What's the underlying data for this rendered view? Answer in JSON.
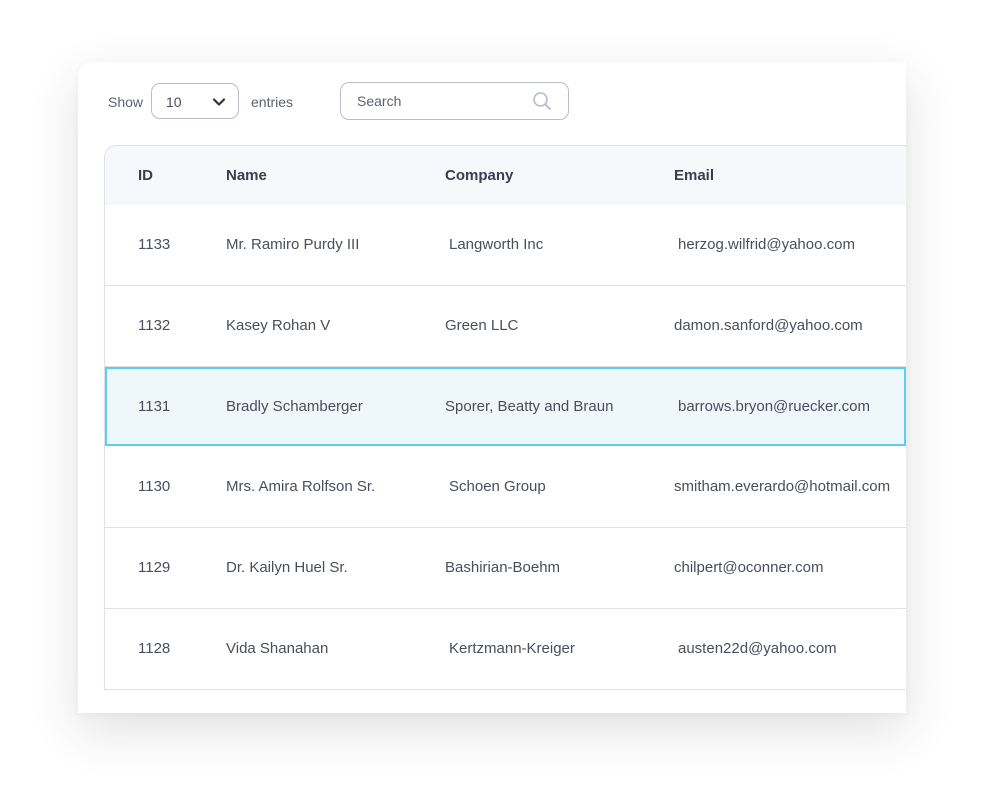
{
  "controls": {
    "show_label": "Show",
    "page_size": "10",
    "entries_label": "entries",
    "search_placeholder": "Search"
  },
  "table": {
    "columns": [
      "ID",
      "Name",
      "Company",
      "Email"
    ],
    "rows": [
      {
        "id": "1133",
        "name": "Mr. Ramiro Purdy III",
        "company": "Langworth Inc",
        "email": "herzog.wilfrid@yahoo.com"
      },
      {
        "id": "1132",
        "name": "Kasey Rohan V",
        "company": "Green LLC",
        "email": "damon.sanford@yahoo.com"
      },
      {
        "id": "1131",
        "name": "Bradly Schamberger",
        "company": "Sporer, Beatty and Braun",
        "email": "barrows.bryon@ruecker.com"
      },
      {
        "id": "1130",
        "name": "Mrs. Amira Rolfson Sr.",
        "company": "Schoen Group",
        "email": "smitham.everardo@hotmail.com"
      },
      {
        "id": "1129",
        "name": "Dr. Kailyn Huel Sr.",
        "company": "Bashirian-Boehm",
        "email": "chilpert@oconner.com"
      },
      {
        "id": "1128",
        "name": "Vida Shanahan",
        "company": "Kertzmann-Kreiger",
        "email": "austen22d@yahoo.com"
      }
    ],
    "selected_row_id": "1131"
  },
  "colors": {
    "selected_border": "#5ccdf0",
    "selected_background": "#eef8fb",
    "header_background": "#f7f8fc",
    "border": "#dfe1ea"
  },
  "icons": {
    "select": "chevron-down-icon",
    "search": "search-icon"
  }
}
